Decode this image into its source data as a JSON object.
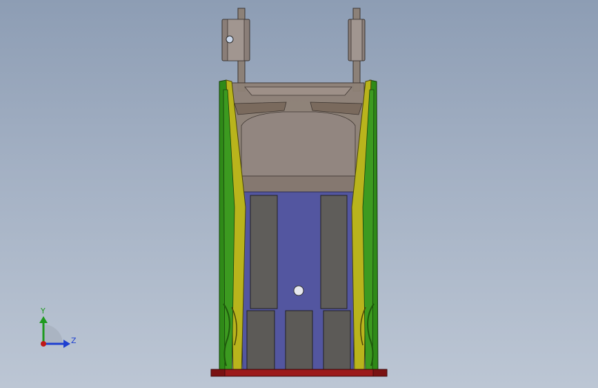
{
  "viewport": {
    "triad": {
      "y_label": "Y",
      "z_label": "Z",
      "y_color": "#1e9a1e",
      "z_color": "#1e3fd0",
      "origin_color": "#c01818"
    }
  },
  "model": {
    "colors": {
      "frame_green": "#2f8a18",
      "frame_yellow": "#b9b41c",
      "bracket_taupe": "#8f8176",
      "plate_blue": "#5356a0",
      "block_gray": "#5f5d5a",
      "base_red": "#9c1a1a",
      "bolt_white": "#e6e8ee"
    }
  }
}
